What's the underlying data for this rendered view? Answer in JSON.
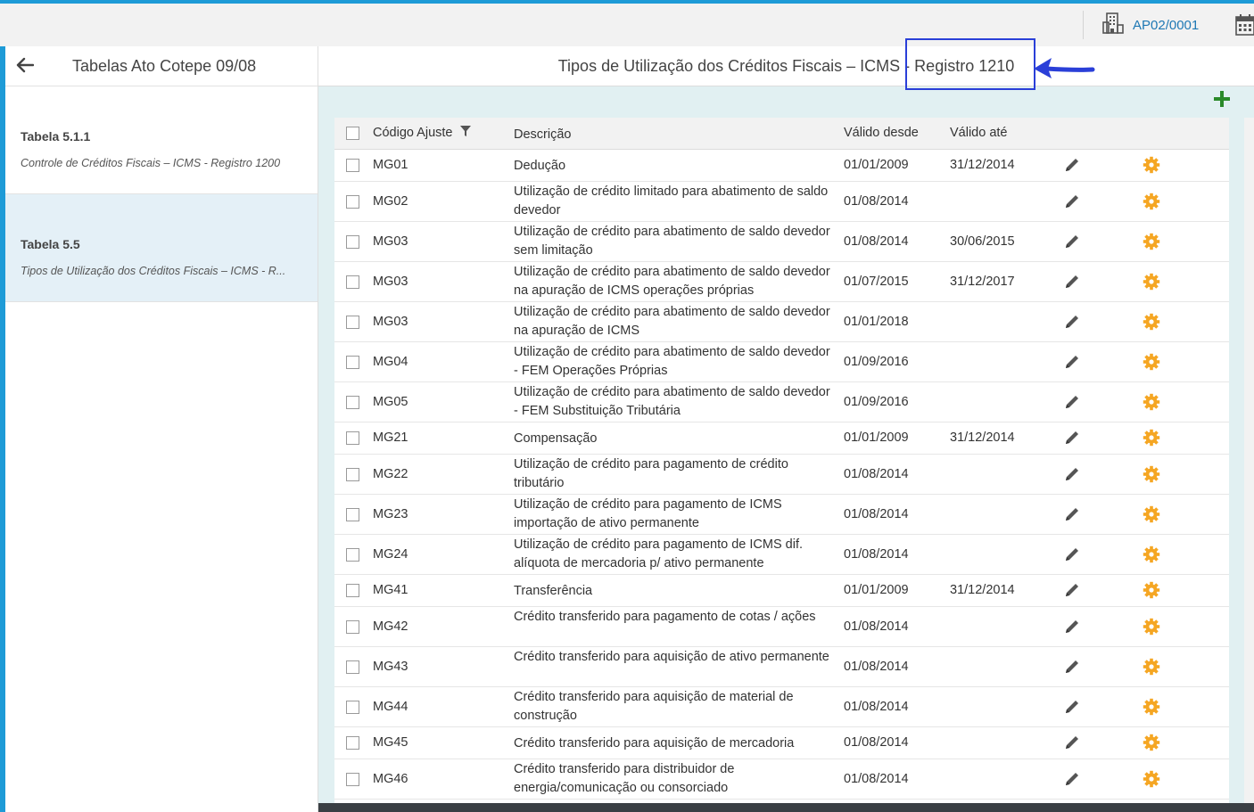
{
  "topbar": {
    "company_code": "AP02/0001",
    "company_icon": "building-icon",
    "calendar_icon": "calendar-icon"
  },
  "sidebar": {
    "title": "Tabelas Ato Cotepe 09/08",
    "items": [
      {
        "title": "Tabela 5.1.1",
        "subtitle": "Controle de Créditos Fiscais – ICMS - Registro 1200"
      },
      {
        "title": "Tabela 5.5",
        "subtitle": "Tipos de Utilização dos Créditos Fiscais – ICMS - R..."
      }
    ]
  },
  "main": {
    "title": "Tipos de Utilização dos Créditos Fiscais – ICMS - Registro 1210"
  },
  "colors": {
    "accent": "#1e9bd7",
    "highlight_box": "#2a3fd8",
    "gear": "#f5a623",
    "add": "#2a8a2a"
  },
  "table": {
    "headers": {
      "code": "Código Ajuste",
      "description": "Descrição",
      "valid_from": "Válido desde",
      "valid_to": "Válido até"
    },
    "rows": [
      {
        "code": "MG01",
        "desc": "Dedução",
        "from": "01/01/2009",
        "to": "31/12/2014"
      },
      {
        "code": "MG02",
        "desc": "Utilização de crédito limitado para abatimento de saldo devedor",
        "from": "01/08/2014",
        "to": ""
      },
      {
        "code": "MG03",
        "desc": "Utilização de crédito para abatimento de saldo devedor sem limitação",
        "from": "01/08/2014",
        "to": "30/06/2015"
      },
      {
        "code": "MG03",
        "desc": "Utilização de crédito para abatimento de saldo devedor na apuração de ICMS operações próprias",
        "from": "01/07/2015",
        "to": "31/12/2017"
      },
      {
        "code": "MG03",
        "desc": "Utilização de crédito para abatimento de saldo devedor na apuração de ICMS",
        "from": "01/01/2018",
        "to": ""
      },
      {
        "code": "MG04",
        "desc": "Utilização de crédito para abatimento de saldo devedor - FEM Operações Próprias",
        "from": "01/09/2016",
        "to": ""
      },
      {
        "code": "MG05",
        "desc": "Utilização de crédito para abatimento de saldo devedor - FEM Substituição Tributária",
        "from": "01/09/2016",
        "to": ""
      },
      {
        "code": "MG21",
        "desc": "Compensação",
        "from": "01/01/2009",
        "to": "31/12/2014"
      },
      {
        "code": "MG22",
        "desc": "Utilização de crédito para pagamento de crédito tributário",
        "from": "01/08/2014",
        "to": ""
      },
      {
        "code": "MG23",
        "desc": "Utilização de crédito para pagamento de ICMS importação de ativo permanente",
        "from": "01/08/2014",
        "to": ""
      },
      {
        "code": "MG24",
        "desc": "Utilização de crédito para pagamento de ICMS dif. alíquota de mercadoria p/ ativo permanente",
        "from": "01/08/2014",
        "to": ""
      },
      {
        "code": "MG41",
        "desc": "Transferência",
        "from": "01/01/2009",
        "to": "31/12/2014"
      },
      {
        "code": "MG42",
        "desc": "Crédito transferido para pagamento de cotas / ações",
        "from": "01/08/2014",
        "to": ""
      },
      {
        "code": "MG43",
        "desc": "Crédito transferido para aquisição de ativo permanente",
        "from": "01/08/2014",
        "to": ""
      },
      {
        "code": "MG44",
        "desc": "Crédito transferido para aquisição de material de construção",
        "from": "01/08/2014",
        "to": ""
      },
      {
        "code": "MG45",
        "desc": "Crédito transferido para aquisição de mercadoria",
        "from": "01/08/2014",
        "to": ""
      },
      {
        "code": "MG46",
        "desc": "Crédito transferido para distribuidor de energia/comunicação ou consorciado",
        "from": "01/08/2014",
        "to": ""
      }
    ]
  }
}
